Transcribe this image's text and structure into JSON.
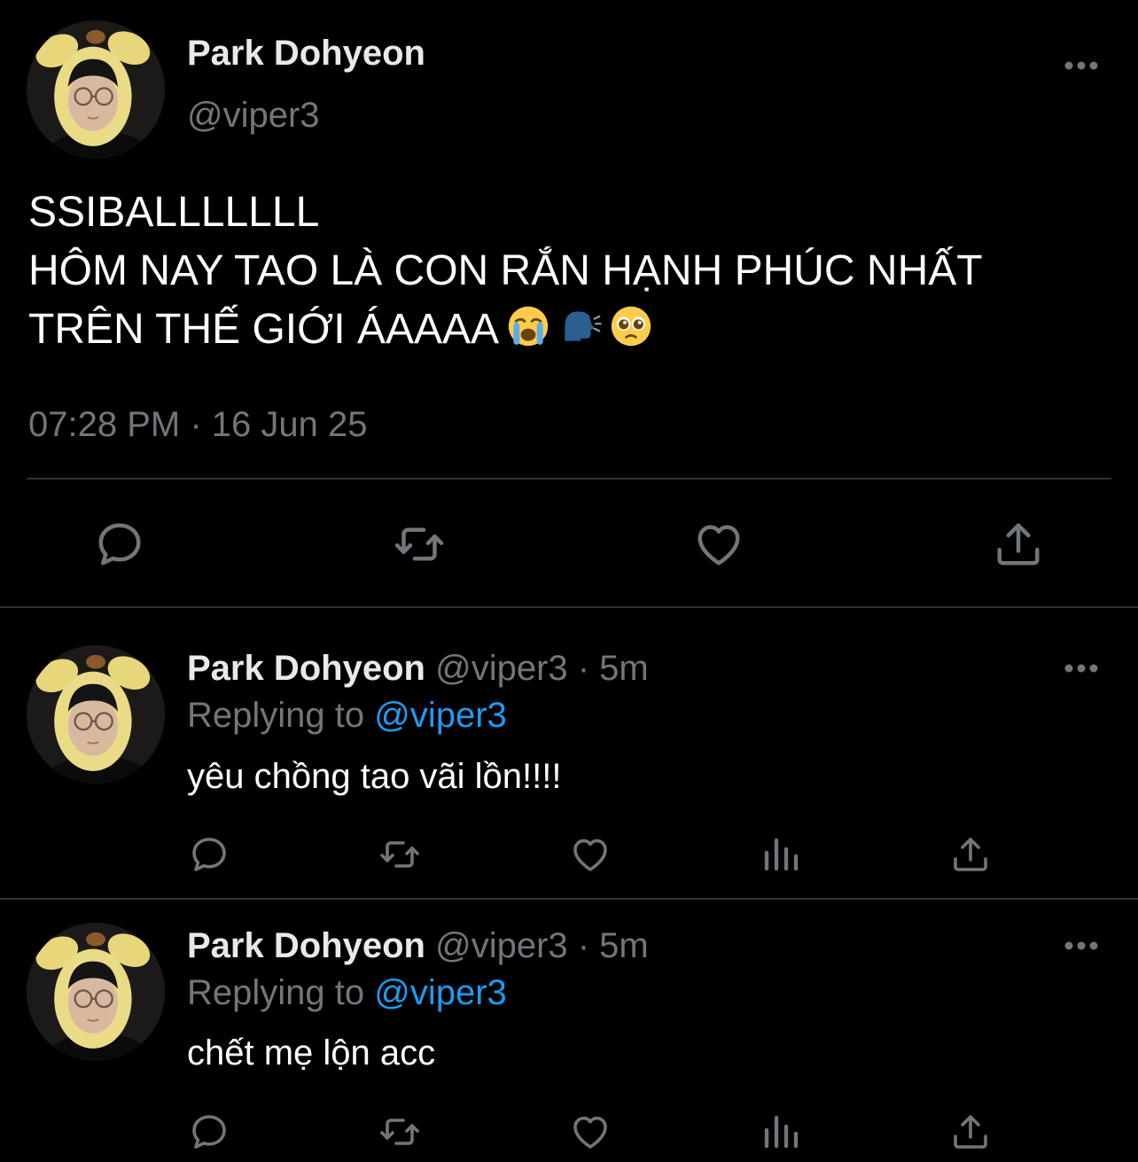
{
  "main_tweet": {
    "author_name": "Park Dohyeon",
    "author_handle": "@viper3",
    "text_lines": [
      "SSIBALLLLLLL",
      "HÔM NAY TAO LÀ CON RẮN HẠNH PHÚC NHẤT",
      "TRÊN THẾ GIỚI ÁAAAA"
    ],
    "emojis": [
      "loudly-crying-face",
      "speaking-head",
      "pleading-face"
    ],
    "timestamp": "07:28 PM · 16 Jun 25",
    "actions": [
      "reply-icon",
      "retweet-icon",
      "like-icon",
      "share-icon"
    ]
  },
  "replies": [
    {
      "author_name": "Park Dohyeon",
      "meta": " @viper3 · 5m",
      "replying_prefix": "Replying to ",
      "replying_handle": "@viper3",
      "text": "yêu chồng tao vãi lồn!!!!",
      "actions": [
        "reply-icon",
        "retweet-icon",
        "like-icon",
        "analytics-icon",
        "share-icon"
      ]
    },
    {
      "author_name": "Park Dohyeon",
      "meta": " @viper3 · 5m",
      "replying_prefix": "Replying to ",
      "replying_handle": "@viper3",
      "text": "chết mẹ lộn acc",
      "actions": [
        "reply-icon",
        "retweet-icon",
        "like-icon",
        "analytics-icon",
        "share-icon"
      ]
    }
  ],
  "colors": {
    "background": "#000000",
    "primary_text": "#e7e9ea",
    "secondary_text": "#71767b",
    "link": "#1d9bf0",
    "divider": "#2f3336"
  }
}
